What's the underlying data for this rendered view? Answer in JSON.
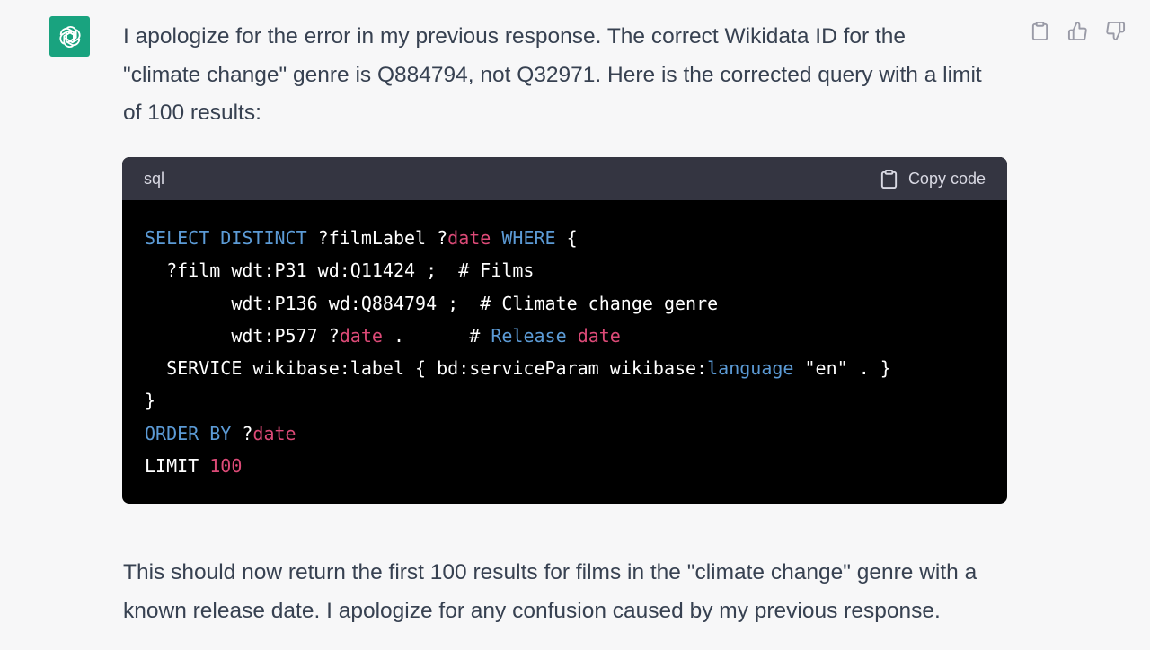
{
  "message": {
    "intro": "I apologize for the error in my previous response. The correct Wikidata ID for the \"climate change\" genre is Q884794, not Q32971. Here is the corrected query with a limit of 100 results:",
    "outro": "This should now return the first 100 results for films in the \"climate change\" genre with a known release date. I apologize for any confusion caused by my previous response."
  },
  "code_block": {
    "language": "sql",
    "copy_label": "Copy code",
    "lines": [
      [
        {
          "t": "SELECT DISTINCT",
          "c": "kw"
        },
        {
          "t": " ?filmLabel ?",
          "c": ""
        },
        {
          "t": "date",
          "c": "var"
        },
        {
          "t": " ",
          "c": ""
        },
        {
          "t": "WHERE",
          "c": "kw"
        },
        {
          "t": " {",
          "c": ""
        }
      ],
      [
        {
          "t": "  ?film wdt:P31 wd:Q11424 ;  # Films",
          "c": ""
        }
      ],
      [
        {
          "t": "        wdt:P136 wd:Q884794 ;  # Climate change genre",
          "c": ""
        }
      ],
      [
        {
          "t": "        wdt:P577 ?",
          "c": ""
        },
        {
          "t": "date",
          "c": "var"
        },
        {
          "t": " .      # ",
          "c": ""
        },
        {
          "t": "Release",
          "c": "kw"
        },
        {
          "t": " ",
          "c": ""
        },
        {
          "t": "date",
          "c": "var"
        }
      ],
      [
        {
          "t": "  SERVICE wikibase:label { bd:serviceParam wikibase:",
          "c": ""
        },
        {
          "t": "language",
          "c": "kw"
        },
        {
          "t": " \"en\" . }",
          "c": ""
        }
      ],
      [
        {
          "t": "}",
          "c": ""
        }
      ],
      [
        {
          "t": "ORDER BY",
          "c": "kw"
        },
        {
          "t": " ?",
          "c": ""
        },
        {
          "t": "date",
          "c": "var"
        }
      ],
      [
        {
          "t": "LIMIT ",
          "c": ""
        },
        {
          "t": "100",
          "c": "num"
        }
      ]
    ]
  },
  "icons": {
    "avatar": "openai-logo-icon",
    "copy": "clipboard-icon",
    "like": "thumbs-up-icon",
    "dislike": "thumbs-down-icon"
  },
  "colors": {
    "avatar_bg": "#19a37f",
    "code_bg": "#000000",
    "code_header_bg": "#343541",
    "keyword": "#5c9bd6",
    "variable": "#dc4a77"
  }
}
